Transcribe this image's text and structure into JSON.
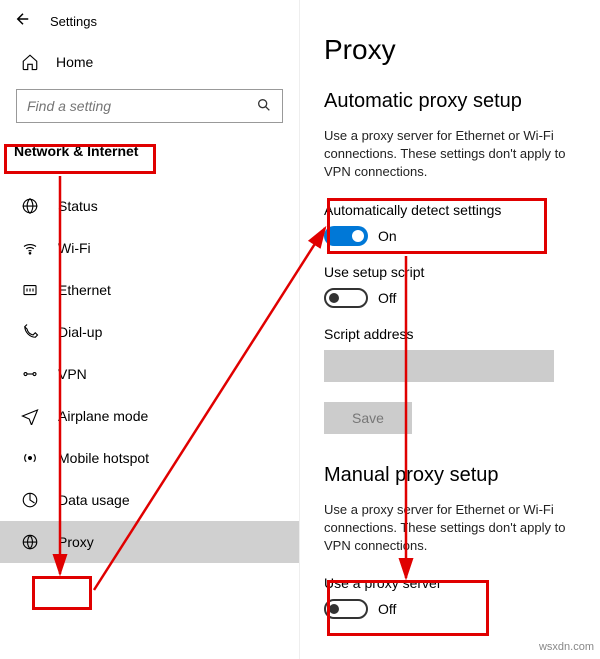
{
  "titlebar": {
    "label": "Settings"
  },
  "home": {
    "label": "Home"
  },
  "search": {
    "placeholder": "Find a setting"
  },
  "section": "Network & Internet",
  "nav": {
    "items": [
      {
        "label": "Status"
      },
      {
        "label": "Wi-Fi"
      },
      {
        "label": "Ethernet"
      },
      {
        "label": "Dial-up"
      },
      {
        "label": "VPN"
      },
      {
        "label": "Airplane mode"
      },
      {
        "label": "Mobile hotspot"
      },
      {
        "label": "Data usage"
      },
      {
        "label": "Proxy"
      }
    ]
  },
  "page": {
    "title": "Proxy",
    "auto": {
      "heading": "Automatic proxy setup",
      "desc": "Use a proxy server for Ethernet or Wi-Fi connections. These settings don't apply to VPN connections.",
      "detect_label": "Automatically detect settings",
      "detect_state": "On",
      "script_label": "Use setup script",
      "script_state": "Off",
      "address_label": "Script address",
      "save_label": "Save"
    },
    "manual": {
      "heading": "Manual proxy setup",
      "desc": "Use a proxy server for Ethernet or Wi-Fi connections. These settings don't apply to VPN connections.",
      "use_label": "Use a proxy server",
      "use_state": "Off"
    }
  },
  "watermark": "wsxdn.com"
}
